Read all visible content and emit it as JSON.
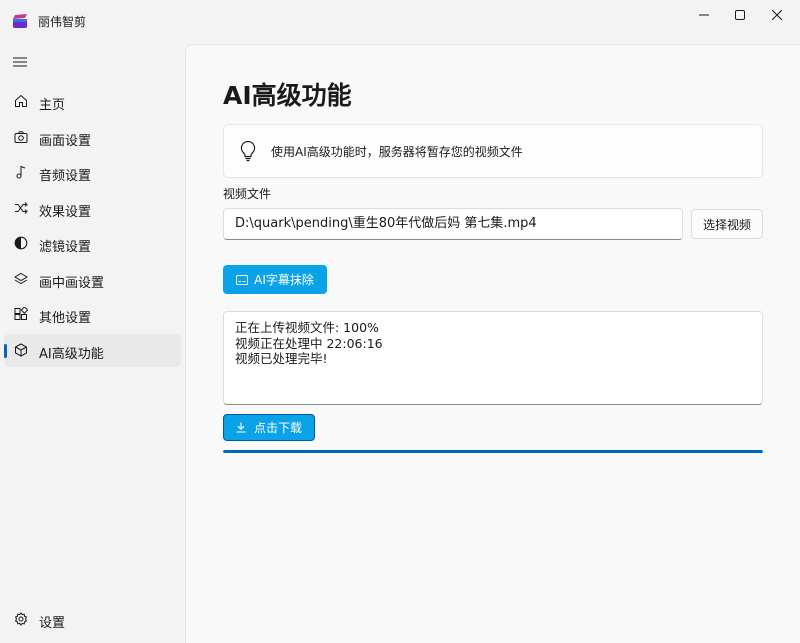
{
  "window": {
    "title": "丽伟智剪",
    "controls": [
      "minimize-icon",
      "maximize-icon",
      "close-icon"
    ]
  },
  "sidebar": {
    "items": [
      {
        "label": "主页",
        "icon": "home-icon",
        "active": false
      },
      {
        "label": "画面设置",
        "icon": "camera-icon",
        "active": false
      },
      {
        "label": "音频设置",
        "icon": "music-note-icon",
        "active": false
      },
      {
        "label": "效果设置",
        "icon": "shuffle-icon",
        "active": false
      },
      {
        "label": "滤镜设置",
        "icon": "contrast-icon",
        "active": false
      },
      {
        "label": "画中画设置",
        "icon": "layers-icon",
        "active": false
      },
      {
        "label": "其他设置",
        "icon": "apps-icon",
        "active": false
      },
      {
        "label": "AI高级功能",
        "icon": "cube-icon",
        "active": true
      }
    ],
    "settings_label": "设置"
  },
  "main": {
    "page_title": "AI高级功能",
    "info_text": "使用AI高级功能时，服务器将暂存您的视频文件",
    "file_label": "视频文件",
    "file_path": "D:\\quark\\pending\\重生80年代做后妈 第七集.mp4",
    "choose_button": "选择视频",
    "ai_button": "AI字幕抹除",
    "log_lines": [
      "正在上传视频文件: 100%",
      "视频正在处理中 22:06:16",
      "视频已处理完毕!"
    ],
    "download_button": "点击下载",
    "progress": 1.0
  },
  "colors": {
    "accent": "#0067c0",
    "button_blue": "#0aa3e8",
    "sidebar_bg": "#f3f3f3",
    "content_bg": "#f9f9f9"
  }
}
